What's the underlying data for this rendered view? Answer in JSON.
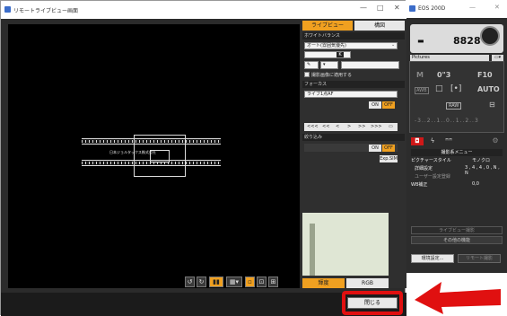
{
  "remote": {
    "title": "リモートライブビュー画面",
    "win_min": "—",
    "win_max": "□",
    "win_close": "✕"
  },
  "viewer": {
    "ruler_label": "日本ジョルタックス株式会社"
  },
  "panel": {
    "tab_liveview": "ライブビュー",
    "tab_composition": "構図",
    "wb_header": "ホワイトバランス",
    "wb_value": "オート(雰囲気優先)",
    "wb_mark": "K",
    "apply_wb_label": "撮影画像に適用する",
    "focus_header": "フォーカス",
    "af_mode": "ライブ1点AF",
    "on": "ON",
    "off": "OFF",
    "focus_buttons": [
      "<<<",
      "<<",
      "<",
      ">",
      ">>",
      ">>>"
    ],
    "dof_header": "絞り込み",
    "dof_on": "ON",
    "dof_off": "OFF",
    "exp_sim": "Exp.SIM",
    "hist_tab_brightness": "輝度",
    "hist_tab_rgb": "RGB"
  },
  "bottom": {
    "close_label": "閉じる"
  },
  "camera": {
    "title": "EOS 200D",
    "shots_remaining": "8828",
    "folder": "Pictures",
    "mode": "M",
    "shutter": "0\"3",
    "aperture": "F10",
    "awb": "AWB",
    "af": "AUTO",
    "raw": "RAW",
    "shoot_menu_title": "撮影系メニュー",
    "picture_style_label": "ピクチャースタイル",
    "picture_style_value": "モノクロ",
    "detail_label": "詳細設定",
    "detail_value": "3 , 4 , 4 , 0 , N , N",
    "user_def_label": "ユーザー設定登録",
    "wb_shift_label": "WB補正",
    "wb_shift_value": "0,0",
    "liveview_btn": "ライブビュー撮影",
    "other_btn": "その他の機能",
    "preferences_btn": "環境設定...",
    "remote_btn": "リモート撮影"
  },
  "colors": {
    "accent_orange": "#f0a020",
    "highlight_red": "#e01010",
    "camera_tab_red": "#d01818"
  }
}
